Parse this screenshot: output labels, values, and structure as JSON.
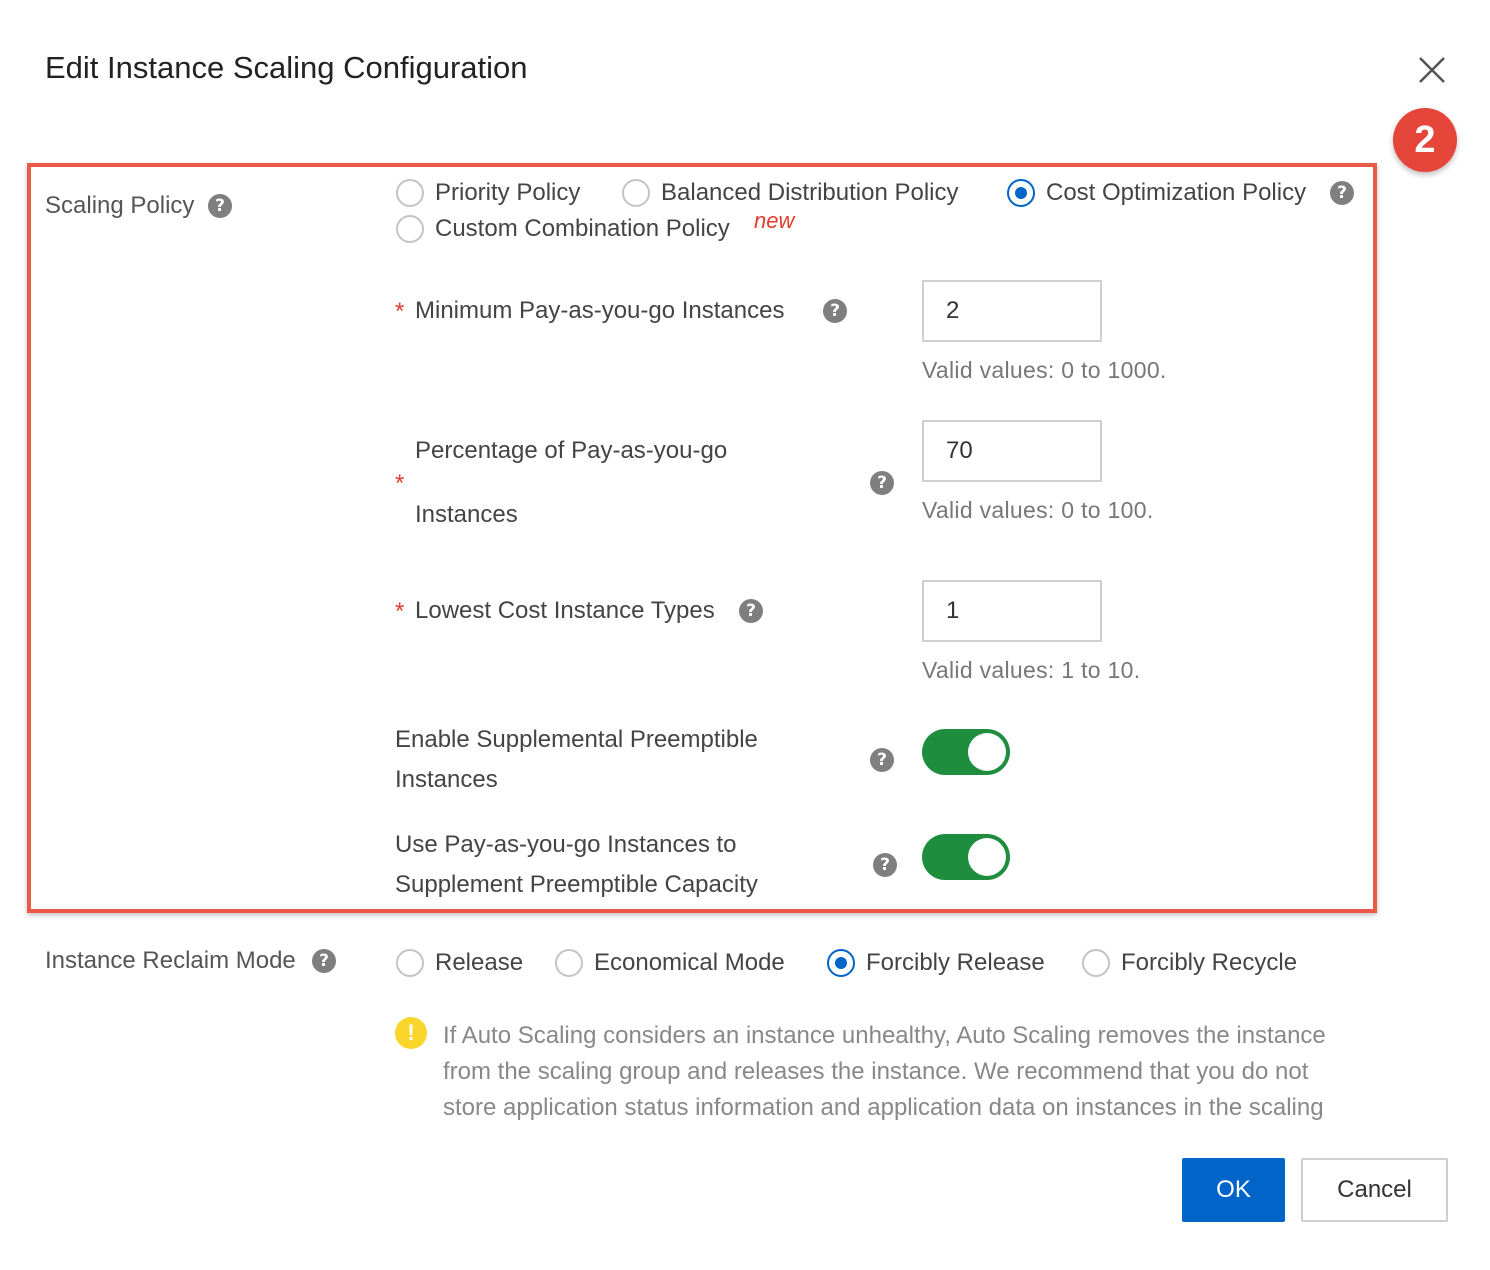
{
  "dialog": {
    "title": "Edit Instance Scaling Configuration",
    "step_badge": "2"
  },
  "scaling_policy": {
    "label": "Scaling Policy",
    "options": [
      {
        "label": "Priority Policy",
        "selected": false
      },
      {
        "label": "Balanced Distribution Policy",
        "selected": false
      },
      {
        "label": "Cost Optimization Policy",
        "selected": true
      },
      {
        "label": "Custom Combination Policy",
        "selected": false,
        "tag": "new"
      }
    ]
  },
  "fields": {
    "min_payg": {
      "label": "Minimum Pay-as-you-go Instances",
      "value": "2",
      "hint": "Valid values: 0 to 1000."
    },
    "pct_payg": {
      "label_line1": "Percentage of Pay-as-you-go",
      "label_line2": "Instances",
      "value": "70",
      "hint": "Valid values: 0 to 100."
    },
    "lowest_cost": {
      "label": "Lowest Cost Instance Types",
      "value": "1",
      "hint": "Valid values: 1 to 10."
    },
    "supplemental_preemptible": {
      "label_line1": "Enable Supplemental Preemptible",
      "label_line2": "Instances",
      "enabled": true
    },
    "payg_supplement": {
      "label_line1": "Use Pay-as-you-go Instances to",
      "label_line2": "Supplement Preemptible Capacity",
      "enabled": true
    }
  },
  "reclaim_mode": {
    "label": "Instance Reclaim Mode",
    "options": [
      {
        "label": "Release",
        "selected": false
      },
      {
        "label": "Economical Mode",
        "selected": false
      },
      {
        "label": "Forcibly Release",
        "selected": true
      },
      {
        "label": "Forcibly Recycle",
        "selected": false
      }
    ],
    "warning_lines": [
      "If Auto Scaling considers an instance unhealthy, Auto Scaling removes the instance",
      "from the scaling group and releases the instance. We recommend that you do not",
      "store application status information and application data on instances in the scaling"
    ]
  },
  "footer": {
    "ok_label": "OK",
    "cancel_label": "Cancel"
  },
  "symbols": {
    "required": "*",
    "help": "?",
    "warning": "!"
  },
  "colors": {
    "primary": "#0064c8",
    "toggle_on": "#1e8e3e",
    "highlight": "#eb5a46",
    "warning": "#fad52b",
    "required": "#e23c2c"
  }
}
